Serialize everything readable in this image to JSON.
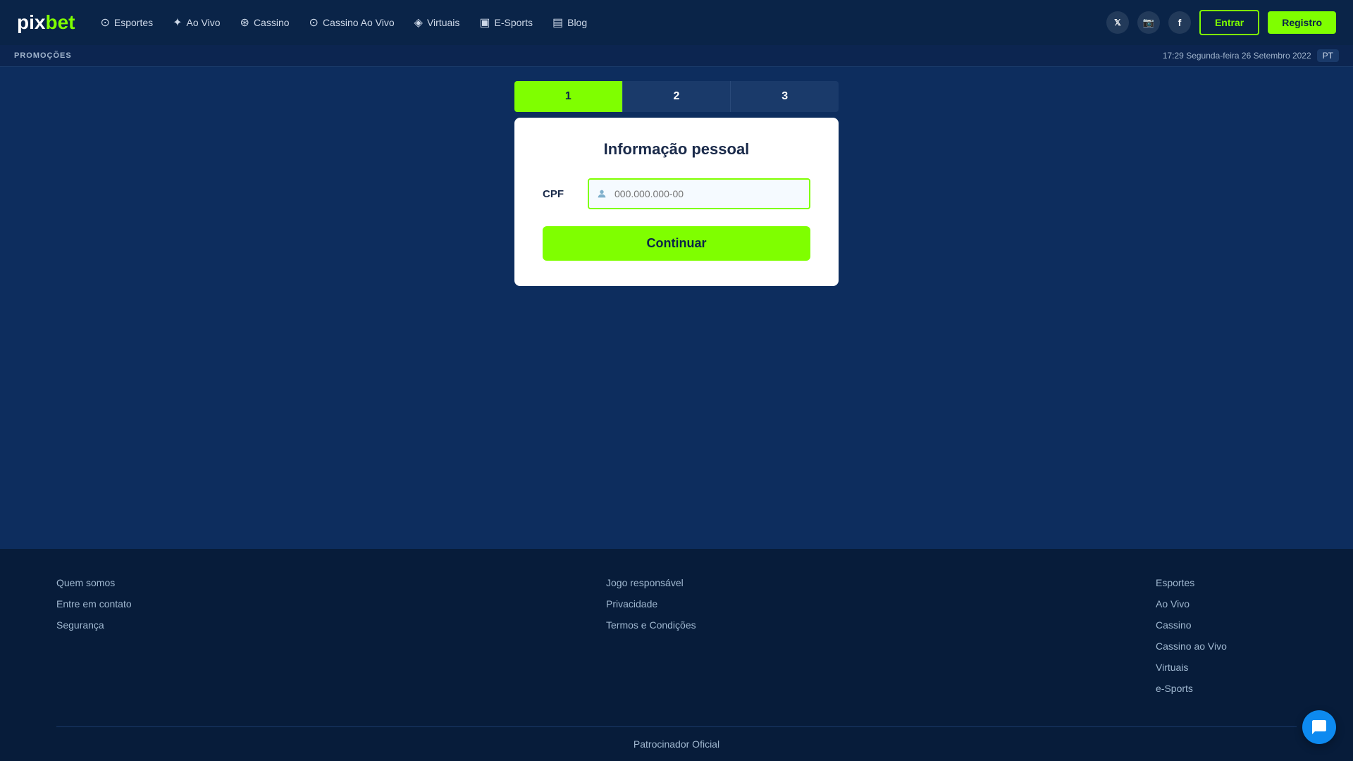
{
  "header": {
    "logo_pix": "pix",
    "logo_bet": "bet",
    "nav": [
      {
        "id": "esportes",
        "label": "Esportes",
        "icon": "⊙"
      },
      {
        "id": "ao-vivo",
        "label": "Ao Vivo",
        "icon": "✦"
      },
      {
        "id": "cassino",
        "label": "Cassino",
        "icon": "⊛"
      },
      {
        "id": "cassino-ao-vivo",
        "label": "Cassino Ao Vivo",
        "icon": "⊙"
      },
      {
        "id": "virtuais",
        "label": "Virtuais",
        "icon": "◈"
      },
      {
        "id": "e-sports",
        "label": "E-Sports",
        "icon": "▣"
      },
      {
        "id": "blog",
        "label": "Blog",
        "icon": "▤"
      }
    ],
    "social": [
      {
        "id": "twitter",
        "icon": "𝕏",
        "label": "Twitter"
      },
      {
        "id": "instagram",
        "icon": "📷",
        "label": "Instagram"
      },
      {
        "id": "facebook",
        "icon": "f",
        "label": "Facebook"
      }
    ],
    "btn_entrar": "Entrar",
    "btn_registro": "Registro"
  },
  "promo_bar": {
    "label": "PROMOÇÕES",
    "datetime": "17:29 Segunda-feira 26 Setembro 2022",
    "lang": "PT"
  },
  "steps": [
    {
      "id": "step-1",
      "label": "1"
    },
    {
      "id": "step-2",
      "label": "2"
    },
    {
      "id": "step-3",
      "label": "3"
    }
  ],
  "form": {
    "title": "Informação pessoal",
    "cpf_label": "CPF",
    "cpf_placeholder": "000.000.000-00",
    "cpf_icon": "👤",
    "btn_continuar": "Continuar"
  },
  "footer": {
    "col1": {
      "links": [
        {
          "label": "Quem somos"
        },
        {
          "label": "Entre em contato"
        },
        {
          "label": "Segurança"
        }
      ]
    },
    "col2": {
      "links": [
        {
          "label": "Jogo responsável"
        },
        {
          "label": "Privacidade"
        },
        {
          "label": "Termos e Condições"
        }
      ]
    },
    "col3": {
      "links": [
        {
          "label": "Esportes"
        },
        {
          "label": "Ao Vivo"
        },
        {
          "label": "Cassino"
        },
        {
          "label": "Cassino ao Vivo"
        },
        {
          "label": "Virtuais"
        },
        {
          "label": "e-Sports"
        }
      ]
    },
    "bottom": "Patrocinador Oficial"
  }
}
